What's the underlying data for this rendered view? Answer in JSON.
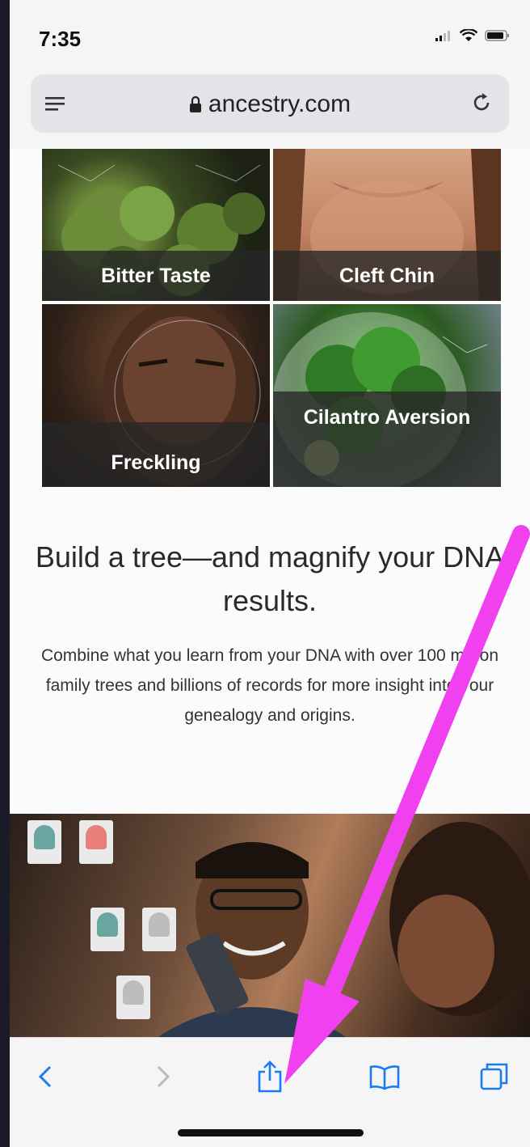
{
  "status_bar": {
    "time": "7:35"
  },
  "browser": {
    "url": "ancestry.com"
  },
  "traits": [
    {
      "label": "Bitter Taste"
    },
    {
      "label": "Cleft Chin"
    },
    {
      "label": "Freckling"
    },
    {
      "label": "Cilantro Aversion"
    }
  ],
  "section": {
    "headline": "Build a tree—and magnify your DNA results.",
    "body": "Combine what you learn from your DNA with over 100 million family trees and billions of records for more insight into your genealogy and origins."
  },
  "toolbar": {
    "items": [
      "back-icon",
      "forward-icon",
      "share-icon",
      "bookmarks-icon",
      "tabs-icon"
    ]
  },
  "colors": {
    "accent": "#1a7cf2",
    "annotation_arrow": "#f040f0"
  }
}
